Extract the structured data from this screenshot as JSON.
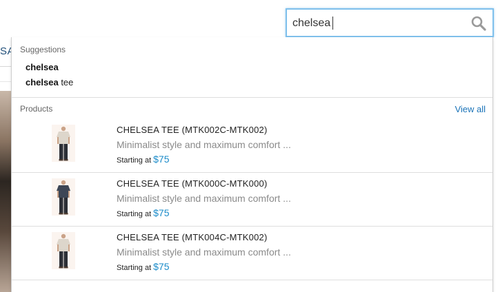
{
  "background": {
    "nav_fragment": "SA"
  },
  "search": {
    "value": "chelsea",
    "placeholder": ""
  },
  "dropdown": {
    "suggestions_heading": "Suggestions",
    "suggestions": [
      {
        "match": "chelsea",
        "rest": ""
      },
      {
        "match": "chelsea",
        "rest": " tee"
      }
    ],
    "products_heading": "Products",
    "view_all_label": "View all",
    "products": [
      {
        "title": "CHELSEA TEE (MTK002C-MTK002)",
        "description": "Minimalist style and maximum comfort ...",
        "price_prefix": "Starting at",
        "price": "$75",
        "shirt_color": "#ddd6cb"
      },
      {
        "title": "CHELSEA TEE (MTK000C-MTK000)",
        "description": "Minimalist style and maximum comfort ...",
        "price_prefix": "Starting at",
        "price": "$75",
        "shirt_color": "#3d4656"
      },
      {
        "title": "CHELSEA TEE (MTK004C-MTK002)",
        "description": "Minimalist style and maximum comfort ...",
        "price_prefix": "Starting at",
        "price": "$75",
        "shirt_color": "#ddd6cb"
      }
    ]
  },
  "colors": {
    "accent_link": "#1a73b8",
    "price": "#1a8bc9",
    "search_focus_border": "#7fc0ec"
  }
}
